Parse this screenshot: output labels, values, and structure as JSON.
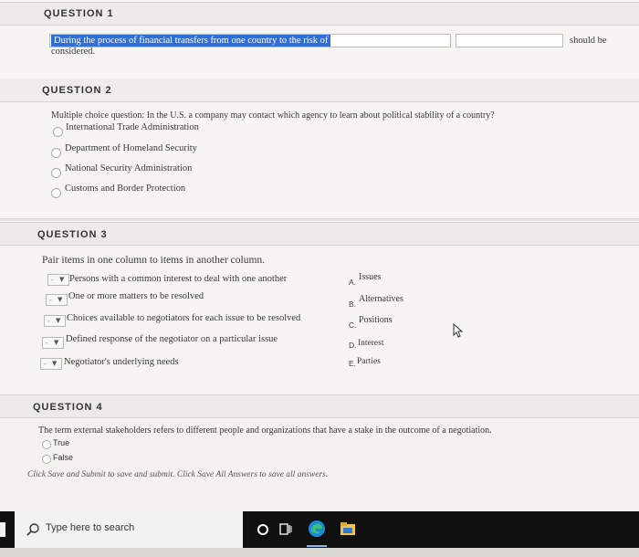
{
  "q1": {
    "header": "QUESTION 1",
    "highlight_text": "During the process of financial transfers from one country to the risk of",
    "continued_text": "considered.",
    "trailing_text": "should be"
  },
  "q2": {
    "header": "QUESTION 2",
    "prompt": "Multiple choice question: In the U.S. a company may contact which agency to learn about political stability of a country?",
    "options": [
      "International Trade Administration",
      "Department of Homeland Security",
      "National Security Administration",
      "Customs and Border Protection"
    ]
  },
  "q3": {
    "header": "QUESTION 3",
    "instructions": "Pair items in one column to items in another column.",
    "select_placeholder": "-",
    "left_items": [
      "Persons with a common interest to deal with one another",
      "One or more matters to be resolved",
      "Choices available to negotiators for each issue to be resolved",
      "Defined response of the negotiator on a particular issue",
      "Negotiator's underlying needs"
    ],
    "right_items": [
      {
        "letter": "A.",
        "text": "Issues"
      },
      {
        "letter": "B.",
        "text": "Alternatives"
      },
      {
        "letter": "C.",
        "text": "Positions"
      },
      {
        "letter": "D.",
        "text": "Interest"
      },
      {
        "letter": "E.",
        "text": "Parties"
      }
    ]
  },
  "q4": {
    "header": "QUESTION 4",
    "prompt": "The term external stakeholders refers to different people and organizations that have a stake in the outcome of a negotiation.",
    "options": [
      "True",
      "False"
    ]
  },
  "footer_hint": "Click Save and Submit to save and submit. Click Save All Answers to save all answers.",
  "taskbar": {
    "search_placeholder": "Type here to search"
  }
}
